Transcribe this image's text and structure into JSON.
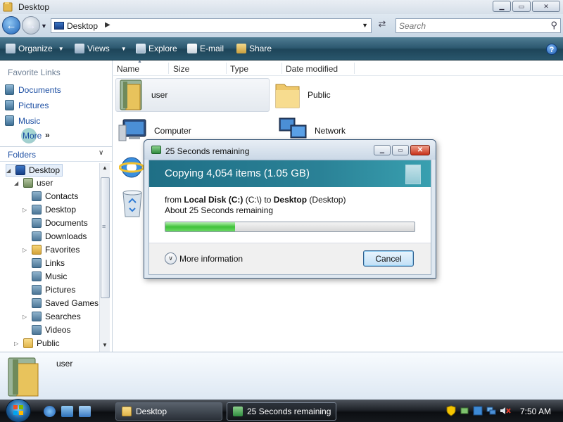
{
  "window": {
    "title": "Desktop",
    "buttons": {
      "minimize": "▁",
      "maximize": "▭",
      "close": "✕"
    }
  },
  "address": {
    "location": "Desktop",
    "search_placeholder": "Search"
  },
  "toolbar": {
    "organize": "Organize",
    "views": "Views",
    "explore": "Explore",
    "email": "E-mail",
    "share": "Share",
    "help": "?"
  },
  "nav": {
    "favorite_links_header": "Favorite Links",
    "favorites": [
      "Documents",
      "Pictures",
      "Music"
    ],
    "more": "More",
    "folders_header": "Folders",
    "tree": [
      "Desktop",
      "user",
      "Contacts",
      "Desktop",
      "Documents",
      "Downloads",
      "Favorites",
      "Links",
      "Music",
      "Pictures",
      "Saved Games",
      "Searches",
      "Videos",
      "Public"
    ]
  },
  "columns": [
    "Name",
    "Size",
    "Type",
    "Date modified"
  ],
  "files": [
    "user",
    "Public",
    "Computer",
    "Network"
  ],
  "details": {
    "name": "user"
  },
  "dialog": {
    "title": "25 Seconds remaining",
    "headline": "Copying 4,054 items (1.05 GB)",
    "from_label": "from",
    "source": "Local Disk (C:)",
    "source_path": "(C:\\)",
    "to_label": "to",
    "destination": "Desktop",
    "destination_paren": "(Desktop)",
    "remaining": "About 25 Seconds remaining",
    "progress": 0.28,
    "more_info": "More information",
    "cancel": "Cancel"
  },
  "taskbar": {
    "tasks": [
      "Desktop",
      "25 Seconds remaining"
    ],
    "clock": "7:50 AM"
  },
  "colors": {
    "toolbar": "#2e5a71",
    "link": "#1d4fa3",
    "progress_fill": "#3fc23a",
    "dialog_banner": "#1f6f86"
  }
}
